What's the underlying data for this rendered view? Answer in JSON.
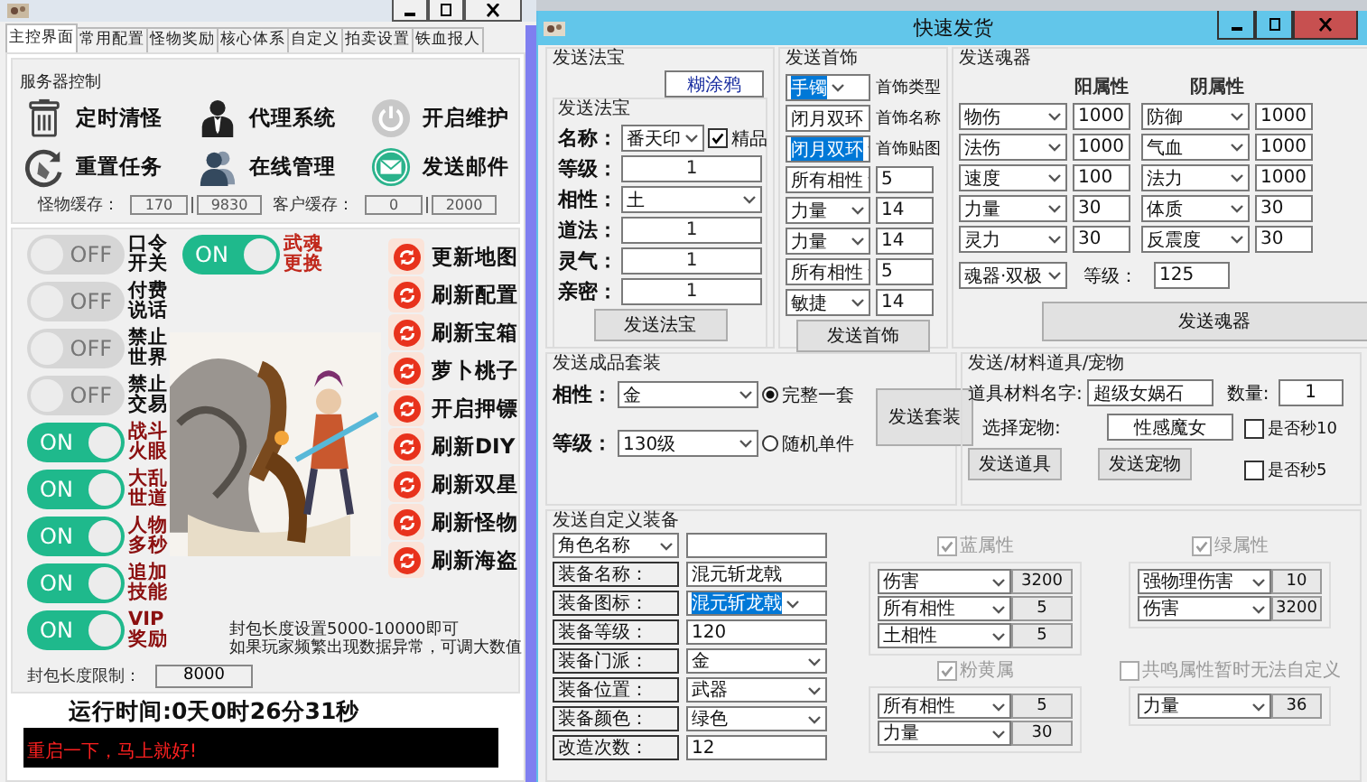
{
  "main_window": {
    "tabs": [
      {
        "label": "主控界面",
        "selected": true
      },
      {
        "label": "常用配置",
        "selected": false
      },
      {
        "label": "怪物奖励",
        "selected": false
      },
      {
        "label": "核心体系",
        "selected": false
      },
      {
        "label": "自定义",
        "selected": false
      },
      {
        "label": "拍卖设置",
        "selected": false
      },
      {
        "label": "铁血报人",
        "selected": false
      }
    ],
    "server_control": {
      "title": "服务器控制",
      "actions": [
        {
          "label": "定时清怪",
          "kind": "trash"
        },
        {
          "label": "代理系统",
          "kind": "agent"
        },
        {
          "label": "开启维护",
          "kind": "power"
        },
        {
          "label": "重置任务",
          "kind": "reset"
        },
        {
          "label": "在线管理",
          "kind": "users"
        },
        {
          "label": "发送邮件",
          "kind": "mail"
        }
      ],
      "caches": [
        {
          "label": "怪物缓存：",
          "values": [
            "170",
            "9830"
          ]
        },
        {
          "label": "客户缓存：",
          "values": [
            "0",
            "2000"
          ]
        }
      ]
    },
    "toggles": [
      {
        "lines": [
          "口令",
          "开关"
        ],
        "on": false,
        "text": "OFF"
      },
      {
        "lines": [
          "付费",
          "说话"
        ],
        "on": false,
        "text": "OFF"
      },
      {
        "lines": [
          "禁止",
          "世界"
        ],
        "on": false,
        "text": "OFF"
      },
      {
        "lines": [
          "禁止",
          "交易"
        ],
        "on": false,
        "text": "OFF"
      },
      {
        "lines": [
          "战斗",
          "火眼"
        ],
        "on": true,
        "text": "ON"
      },
      {
        "lines": [
          "大乱",
          "世道"
        ],
        "on": true,
        "text": "ON"
      },
      {
        "lines": [
          "人物",
          "多秒"
        ],
        "on": true,
        "text": "ON"
      },
      {
        "lines": [
          "追加",
          "技能"
        ],
        "on": true,
        "text": "ON"
      },
      {
        "lines": [
          "VIP",
          "奖励"
        ],
        "on": true,
        "text": "ON"
      }
    ],
    "extra_toggle": {
      "lines": [
        "武魂",
        "更换"
      ],
      "on": true,
      "text": "ON"
    },
    "refresh_buttons": [
      "更新地图",
      "刷新配置",
      "刷新宝箱",
      "萝卜桃子",
      "开启押镖",
      "刷新DIY",
      "刷新双星",
      "刷新怪物",
      "刷新海盗"
    ],
    "packet_limit": {
      "label": "封包长度限制：",
      "value": "8000"
    },
    "notes": [
      "封包长度设置5000-10000即可",
      "如果玩家频繁出现数据异常，可调大数值"
    ],
    "runtime": "运行时间:0天0时26分31秒",
    "log": "重启一下，马上就好!"
  },
  "ship_window": {
    "title": "快速发货",
    "treasure": {
      "title": "发送法宝",
      "target": "糊涂鸦",
      "group_title": "发送法宝",
      "rows": [
        {
          "label": "名称：",
          "field": {
            "kind": "select",
            "value": "番天印"
          },
          "check": {
            "label": "精品",
            "checked": true
          }
        },
        {
          "label": "等级：",
          "field": {
            "kind": "input",
            "value": "1"
          }
        },
        {
          "label": "相性：",
          "field": {
            "kind": "select",
            "value": "土"
          }
        },
        {
          "label": "道法：",
          "field": {
            "kind": "input",
            "value": "1"
          }
        },
        {
          "label": "灵气：",
          "field": {
            "kind": "input",
            "value": "1"
          }
        },
        {
          "label": "亲密：",
          "field": {
            "kind": "input",
            "value": "1"
          }
        }
      ],
      "button": "发送法宝"
    },
    "jewelry": {
      "title": "发送首饰",
      "fields": [
        {
          "field": {
            "kind": "select",
            "value": "手镯",
            "focused": true
          },
          "label": "首饰类型"
        },
        {
          "field": {
            "kind": "input",
            "value": "闭月双环",
            "focused": false
          },
          "label": "首饰名称"
        },
        {
          "field": {
            "kind": "select",
            "value": "闭月双环",
            "focused": true
          },
          "label": "首饰贴图"
        }
      ],
      "attrs": [
        {
          "name": "所有相性",
          "value": "5"
        },
        {
          "name": "力量",
          "value": "14"
        },
        {
          "name": "力量",
          "value": "14"
        },
        {
          "name": "所有相性",
          "value": "5"
        },
        {
          "name": "敏捷",
          "value": "14"
        }
      ],
      "button": "发送首饰"
    },
    "soul": {
      "title": "发送魂器",
      "headers": [
        "阳属性",
        "阴属性"
      ],
      "rows": [
        {
          "yang": "物伤",
          "yang_value": "1000",
          "yin": "防御",
          "yin_value": "1000"
        },
        {
          "yang": "法伤",
          "yang_value": "1000",
          "yin": "气血",
          "yin_value": "1000"
        },
        {
          "yang": "速度",
          "yang_value": "100",
          "yin": "法力",
          "yin_value": "1000"
        },
        {
          "yang": "力量",
          "yang_value": "30",
          "yin": "体质",
          "yin_value": "30"
        },
        {
          "yang": "灵力",
          "yang_value": "30",
          "yin": "反震度",
          "yin_value": "30"
        }
      ],
      "type": "魂器·双极",
      "level_label": "等级：",
      "level": "125",
      "button": "发送魂器"
    },
    "suit": {
      "title": "发送成品套装",
      "affinity_label": "相性：",
      "affinity": "金",
      "level_label": "等级：",
      "level": "130级",
      "options": [
        {
          "label": "完整一套",
          "selected": true
        },
        {
          "label": "随机单件",
          "selected": false
        }
      ],
      "button": "发送套装"
    },
    "items": {
      "title": "发送/材料道具/宠物",
      "item_label": "道具材料名字:",
      "item": "超级女娲石",
      "qty_label": "数量:",
      "qty": "1",
      "pet_label": "选择宠物:",
      "pet": "性感魔女",
      "checks": [
        {
          "label": "是否秒10",
          "checked": false
        },
        {
          "label": "是否秒5",
          "checked": false
        }
      ],
      "buttons": [
        "发送道具",
        "发送宠物"
      ]
    },
    "custom": {
      "title": "发送自定义装备",
      "rows": [
        {
          "label": {
            "kind": "select",
            "value": "角色名称"
          },
          "field": {
            "kind": "input"
          }
        },
        {
          "label": {
            "kind": "tag",
            "value": "装备名称："
          },
          "field": {
            "kind": "input",
            "value": "混元斩龙戟"
          }
        },
        {
          "label": {
            "kind": "tag",
            "value": "装备图标："
          },
          "field": {
            "kind": "select",
            "value": "混元斩龙戟",
            "focused": true
          }
        },
        {
          "label": {
            "kind": "tag",
            "value": "装备等级："
          },
          "field": {
            "kind": "input",
            "value": "120"
          }
        },
        {
          "label": {
            "kind": "tag",
            "value": "装备门派："
          },
          "field": {
            "kind": "select",
            "value": "金"
          }
        },
        {
          "label": {
            "kind": "tag",
            "value": "装备位置："
          },
          "field": {
            "kind": "select",
            "value": "武器"
          }
        },
        {
          "label": {
            "kind": "tag",
            "value": "装备颜色："
          },
          "field": {
            "kind": "select",
            "value": "绿色"
          }
        },
        {
          "label": {
            "kind": "tag",
            "value": "改造次数："
          },
          "field": {
            "kind": "input",
            "value": "12"
          }
        }
      ],
      "groups": [
        {
          "title": "蓝属性",
          "checked": true,
          "disabled": true,
          "attrs": [
            {
              "name": "伤害",
              "value": "3200"
            },
            {
              "name": "所有相性",
              "value": "5"
            },
            {
              "name": "土相性",
              "value": "5"
            }
          ]
        },
        {
          "title": "绿属性",
          "checked": true,
          "disabled": true,
          "attrs": [
            {
              "name": "强物理伤害",
              "value": "10"
            },
            {
              "name": "伤害",
              "value": "3200"
            }
          ]
        },
        {
          "title": "粉黄属",
          "checked": true,
          "disabled": true,
          "attrs": [
            {
              "name": "所有相性",
              "value": "5"
            },
            {
              "name": "力量",
              "value": "30"
            }
          ]
        },
        {
          "title": "共鸣属性暂时无法自定义",
          "checked": false,
          "disabled": true,
          "attrs": [
            {
              "name": "力量",
              "value": "36"
            }
          ]
        }
      ]
    }
  }
}
